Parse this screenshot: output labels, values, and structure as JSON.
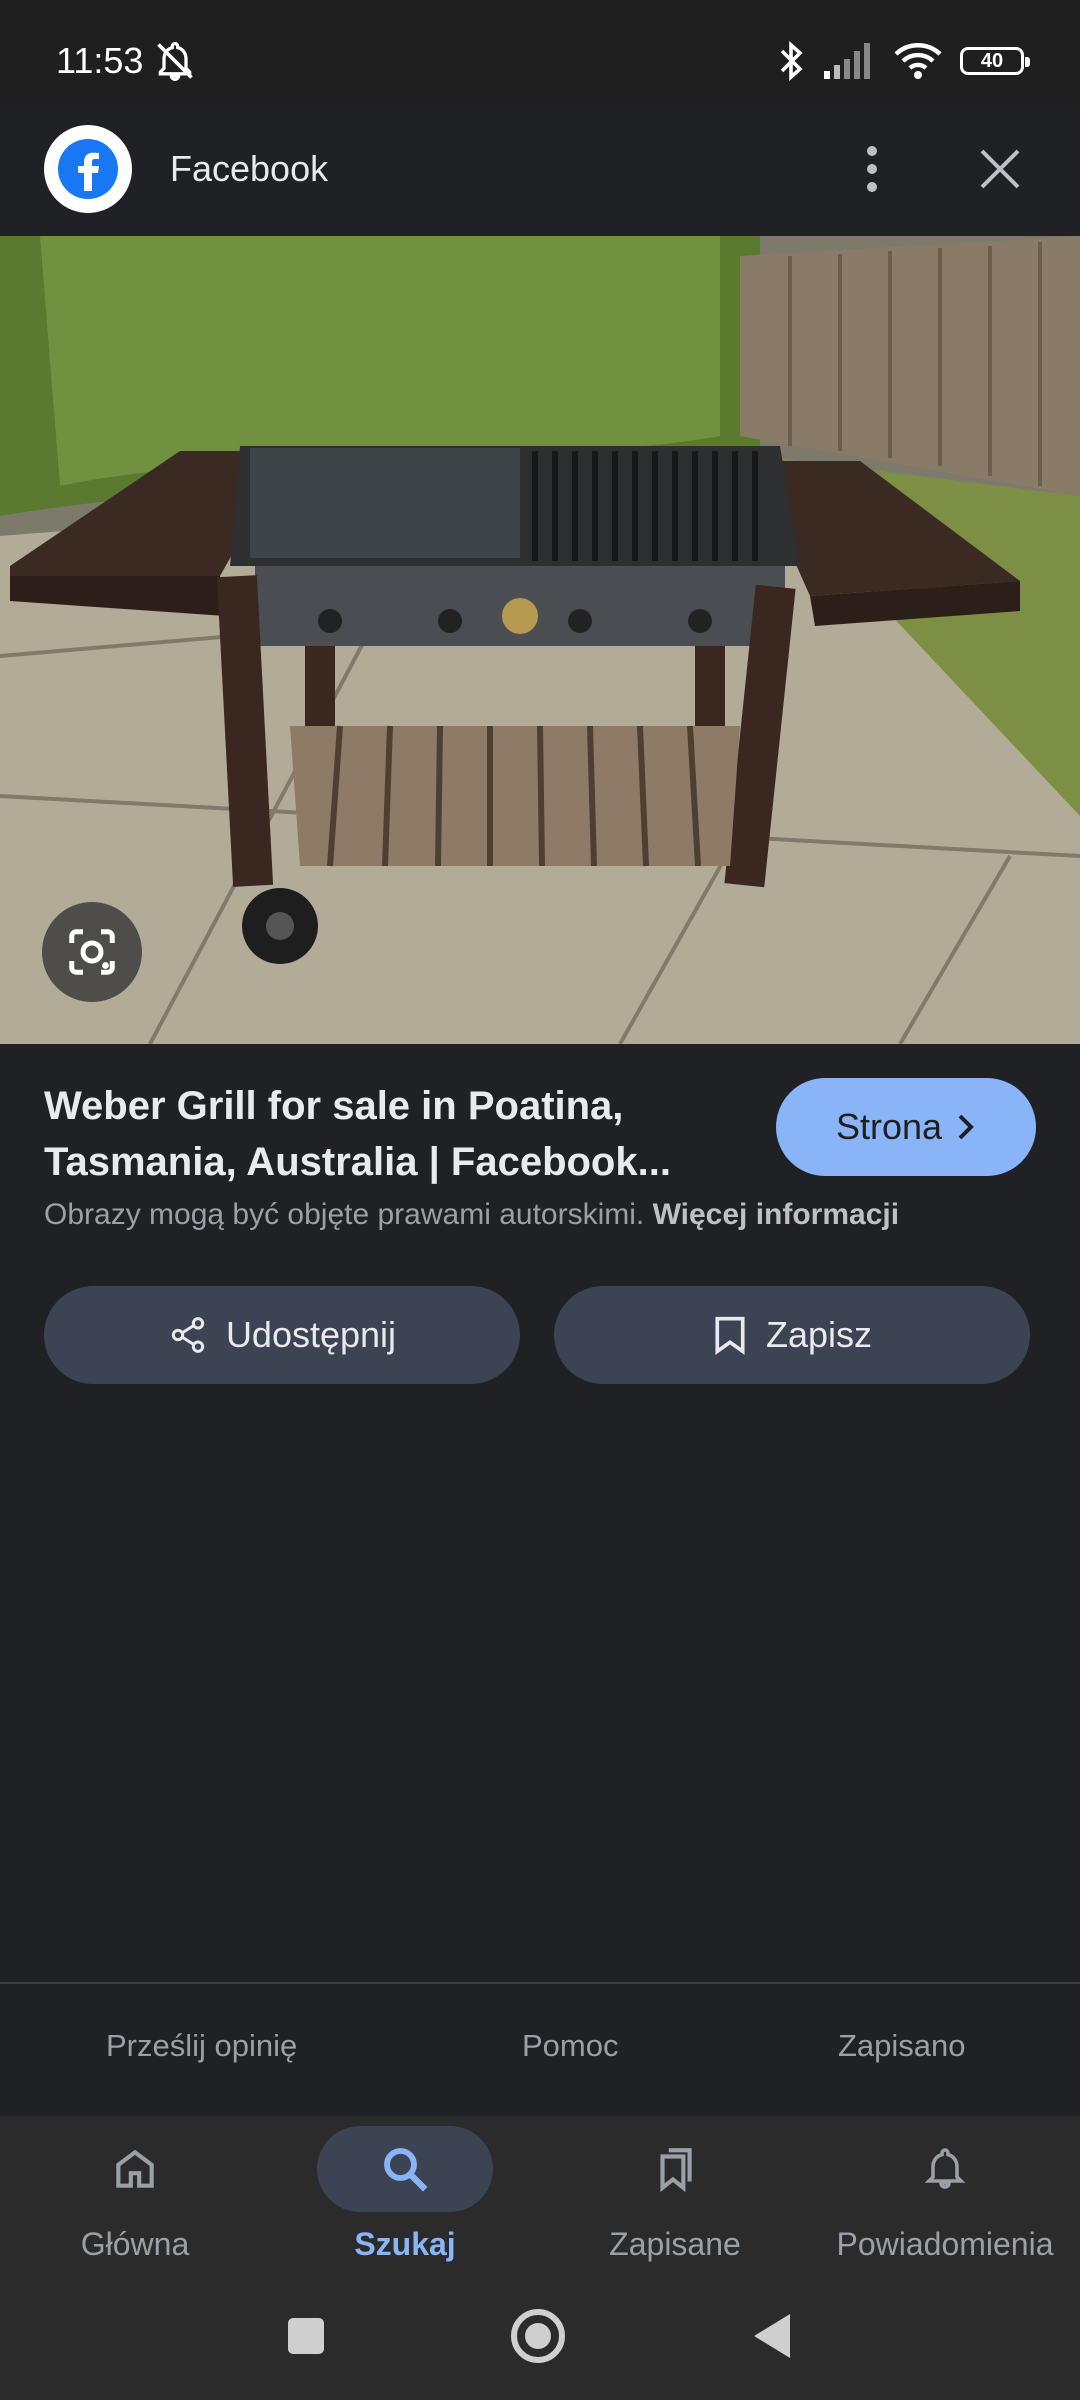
{
  "status_bar": {
    "time": "11:53",
    "battery": "40"
  },
  "header": {
    "site_name": "Facebook"
  },
  "result": {
    "title": "Weber Grill for sale in Poatina, Tasmania, Australia | Facebook...",
    "visit_button": "Strona",
    "copyright_text": "Obrazy mogą być objęte prawami autorskimi.",
    "more_info_link": "Więcej informacji"
  },
  "actions": {
    "share": "Udostępnij",
    "save": "Zapisz"
  },
  "footer": {
    "feedback": "Prześlij opinię",
    "help": "Pomoc",
    "saved": "Zapisano"
  },
  "bottom_nav": [
    {
      "label": "Główna",
      "icon": "home-icon"
    },
    {
      "label": "Szukaj",
      "icon": "search-icon",
      "active": true
    },
    {
      "label": "Zapisane",
      "icon": "collections-icon"
    },
    {
      "label": "Powiadomienia",
      "icon": "bell-icon"
    }
  ],
  "colors": {
    "accent": "#8ab4f8",
    "background": "#202124",
    "pill": "#3c4453"
  }
}
